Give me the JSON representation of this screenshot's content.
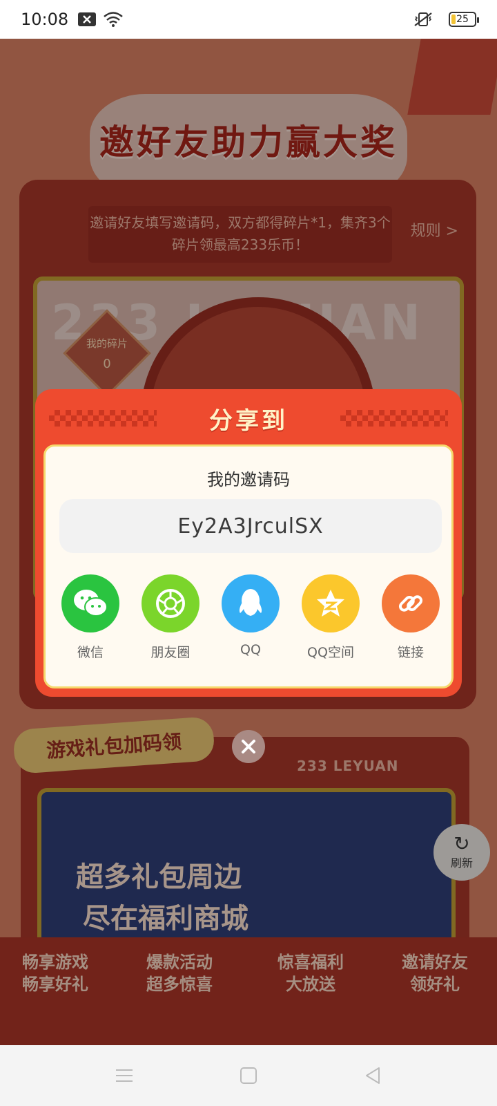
{
  "status_bar": {
    "time": "10:08",
    "battery": "25"
  },
  "background": {
    "hero_title": "邀好友助力赢大奖",
    "banner_text": "邀请好友填写邀请码，双方都得碎片*1，集齐3个碎片领最高233乐币！",
    "rules_link": "规则 >",
    "watermark": "233 LEYUAN",
    "my_fragments_label": "我的碎片",
    "my_fragments_count": "0",
    "gift_section_title": "游戏礼包加码领",
    "leyuan_brand": "233 LEYUAN",
    "promo_line1": "超多礼包周边",
    "promo_line2": "尽在福利商城",
    "refresh_label": "刷新",
    "bottom_items": [
      {
        "line1": "畅享游戏",
        "line2": "畅享好礼"
      },
      {
        "line1": "爆款活动",
        "line2": "超多惊喜"
      },
      {
        "line1": "惊喜福利",
        "line2": "大放送"
      },
      {
        "line1": "邀请好友",
        "line2": "领好礼"
      }
    ]
  },
  "share_dialog": {
    "title": "分享到",
    "invite_label": "我的邀请码",
    "invite_code": "Ey2A3JrculSX",
    "targets": [
      {
        "label": "微信",
        "icon": "wechat-icon",
        "color": "#2ac440"
      },
      {
        "label": "朋友圈",
        "icon": "moments-icon",
        "color": "#7bd52b"
      },
      {
        "label": "QQ",
        "icon": "qq-icon",
        "color": "#35aff4"
      },
      {
        "label": "QQ空间",
        "icon": "qzone-icon",
        "color": "#fbc72c"
      },
      {
        "label": "链接",
        "icon": "link-icon",
        "color": "#f4773a"
      }
    ]
  },
  "colors": {
    "dialog_red": "#ee4b2f",
    "title_gold": "#fff3c8"
  }
}
